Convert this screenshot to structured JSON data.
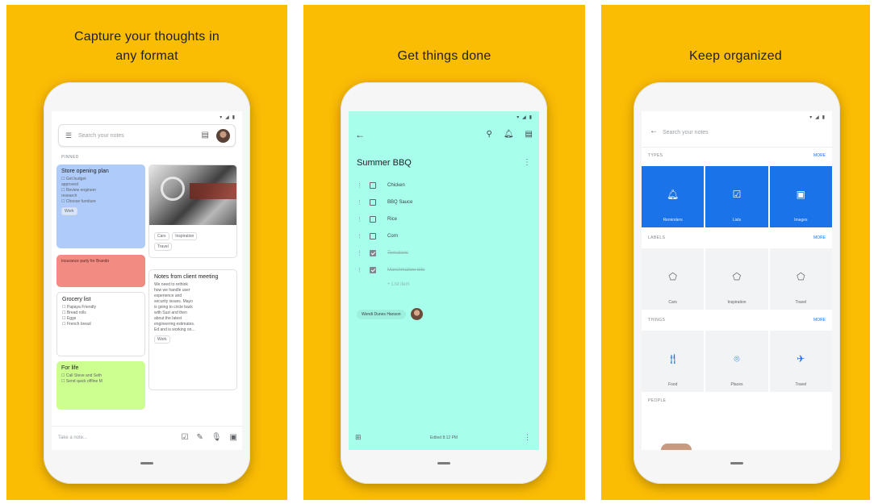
{
  "colors": {
    "panel_bg": "#FBBC04",
    "mint": "#A7FFEB",
    "blue": "#1A73E8"
  },
  "panels": [
    {
      "headline_line1": "Capture your thoughts in",
      "headline_line2": "any format",
      "status": "▾ ◢ ▮",
      "search_placeholder": "Search your notes",
      "section_label": "PINNED",
      "notes": {
        "store": {
          "title": "Store opening plan",
          "lines": [
            "☐ Get budget",
            "approved",
            "☐ Review engineer",
            "research",
            "☐ Choose furniture"
          ],
          "chip": "Work"
        },
        "photo": {
          "chips": [
            "Cars",
            "Inspiration",
            "Travel"
          ]
        },
        "red": {
          "text": "Insurance party for Brando"
        },
        "grocery": {
          "title": "Grocery list",
          "lines": [
            "☐ Papaya Friendly",
            "☐ Bread rolls",
            "☐ Eggs",
            "☐ French bread"
          ]
        },
        "client": {
          "title": "Notes from client meeting",
          "lines": [
            "We need to rethink",
            "how we handle user",
            "experience and",
            "security issues. Mayo",
            "is going to circle back",
            "with Suzi and then",
            "about the latest",
            "engineering estimates.",
            "Ed and is working on..."
          ],
          "chip": "Work"
        },
        "forlife": {
          "title": "For life",
          "lines": [
            "☐ Call Steve and Seth",
            "☐ Send quick offline M"
          ]
        }
      },
      "take_note": "Take a note...",
      "bottom_icons": [
        "checkbox-icon",
        "brush-icon",
        "mic-icon",
        "image-icon"
      ]
    },
    {
      "headline": "Get things done",
      "status": "▾ ◢ ▮",
      "note_title": "Summer BBQ",
      "items": [
        {
          "label": "Chicken",
          "checked": false
        },
        {
          "label": "BBQ Sauce",
          "checked": false
        },
        {
          "label": "Rice",
          "checked": false
        },
        {
          "label": "Corn",
          "checked": false
        },
        {
          "label": "Tomatoes",
          "checked": true
        },
        {
          "label": "Marshmallow bits",
          "checked": true
        }
      ],
      "add_item": "+ List item",
      "collaborator": "Wendi Dunes Hanson",
      "edited": "Edited 8:12 PM"
    },
    {
      "headline": "Keep organized",
      "status": "▾ ◢ ▮",
      "search_placeholder": "Search your notes",
      "types": {
        "label": "TYPES",
        "more": "MORE",
        "tiles": [
          {
            "icon": "bell-icon",
            "label": "Reminders"
          },
          {
            "icon": "checkbox-icon",
            "label": "Lists"
          },
          {
            "icon": "image-icon",
            "label": "Images"
          }
        ]
      },
      "labels": {
        "label": "LABELS",
        "more": "MORE",
        "tiles": [
          {
            "icon": "label-icon",
            "label": "Cars"
          },
          {
            "icon": "label-icon",
            "label": "Inspiration"
          },
          {
            "icon": "label-icon",
            "label": "Travel"
          }
        ]
      },
      "things": {
        "label": "THINGS",
        "more": "MORE",
        "tiles": [
          {
            "icon": "food-icon",
            "label": "Food"
          },
          {
            "icon": "place-icon",
            "label": "Places"
          },
          {
            "icon": "travel-icon",
            "label": "Travel"
          }
        ]
      },
      "people_label": "PEOPLE"
    }
  ]
}
